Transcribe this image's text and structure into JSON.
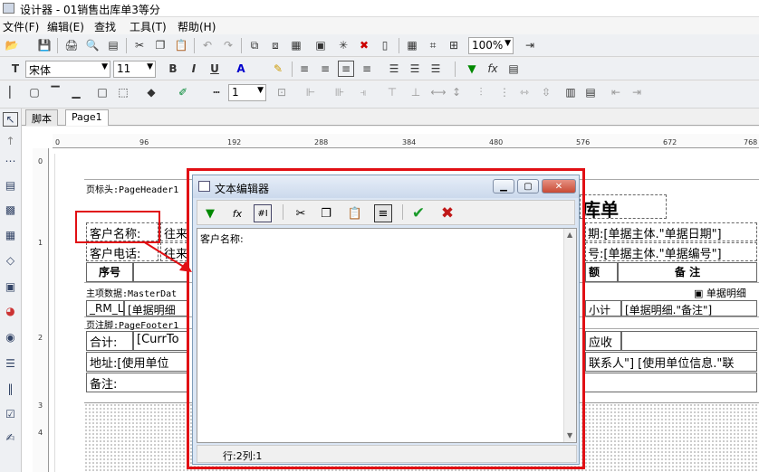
{
  "window": {
    "title": "设计器 - 01销售出库单3等分"
  },
  "menu": [
    "文件(F)",
    "编辑(E)",
    "查找",
    "工具(T)",
    "帮助(H)"
  ],
  "toolbar": {
    "zoom": "100%",
    "font_name": "宋体",
    "font_size": "11",
    "line_width": "1"
  },
  "tabs": [
    "脚本",
    "Page1"
  ],
  "ruler": {
    "h": [
      "0",
      "96",
      "192",
      "288",
      "384",
      "480",
      "576",
      "672",
      "768"
    ],
    "v": [
      "0",
      "1",
      "2",
      "3",
      "4"
    ]
  },
  "report": {
    "pageheader_label": "页标头:PageHeader1",
    "title_tail": "库单",
    "customer_name": "客户名称:",
    "customer_phone": "客户电话:",
    "wanglai1": "往来",
    "wanglai2": "往来",
    "date_prefix": "期:",
    "date_field": "[单据主体.\"单据日期\"]",
    "no_prefix": "号:",
    "no_field": "[单据主体.\"单据编号\"]",
    "col_seq": "序号",
    "col_amount": "额",
    "col_remark": "备  注",
    "masterdata_label": "主项数据:MasterDat",
    "detail_tag": "单据明细",
    "rm_line": "_RM_Line",
    "detail_field": "[单据明细",
    "subtotal": "小计",
    "remark_field": "[单据明细.\"备注\"]",
    "pagefooter_label": "页注脚:PageFooter1",
    "total_label": "合计:",
    "total_field": "[CurrTo",
    "receivable": "应收",
    "address": "地址:[使用单位",
    "contact": "联系人\"] [使用单位信息.\"联",
    "notes": "备注:"
  },
  "dialog": {
    "title": "文本编辑器",
    "content": "客户名称:",
    "status": "行:2列:1"
  }
}
